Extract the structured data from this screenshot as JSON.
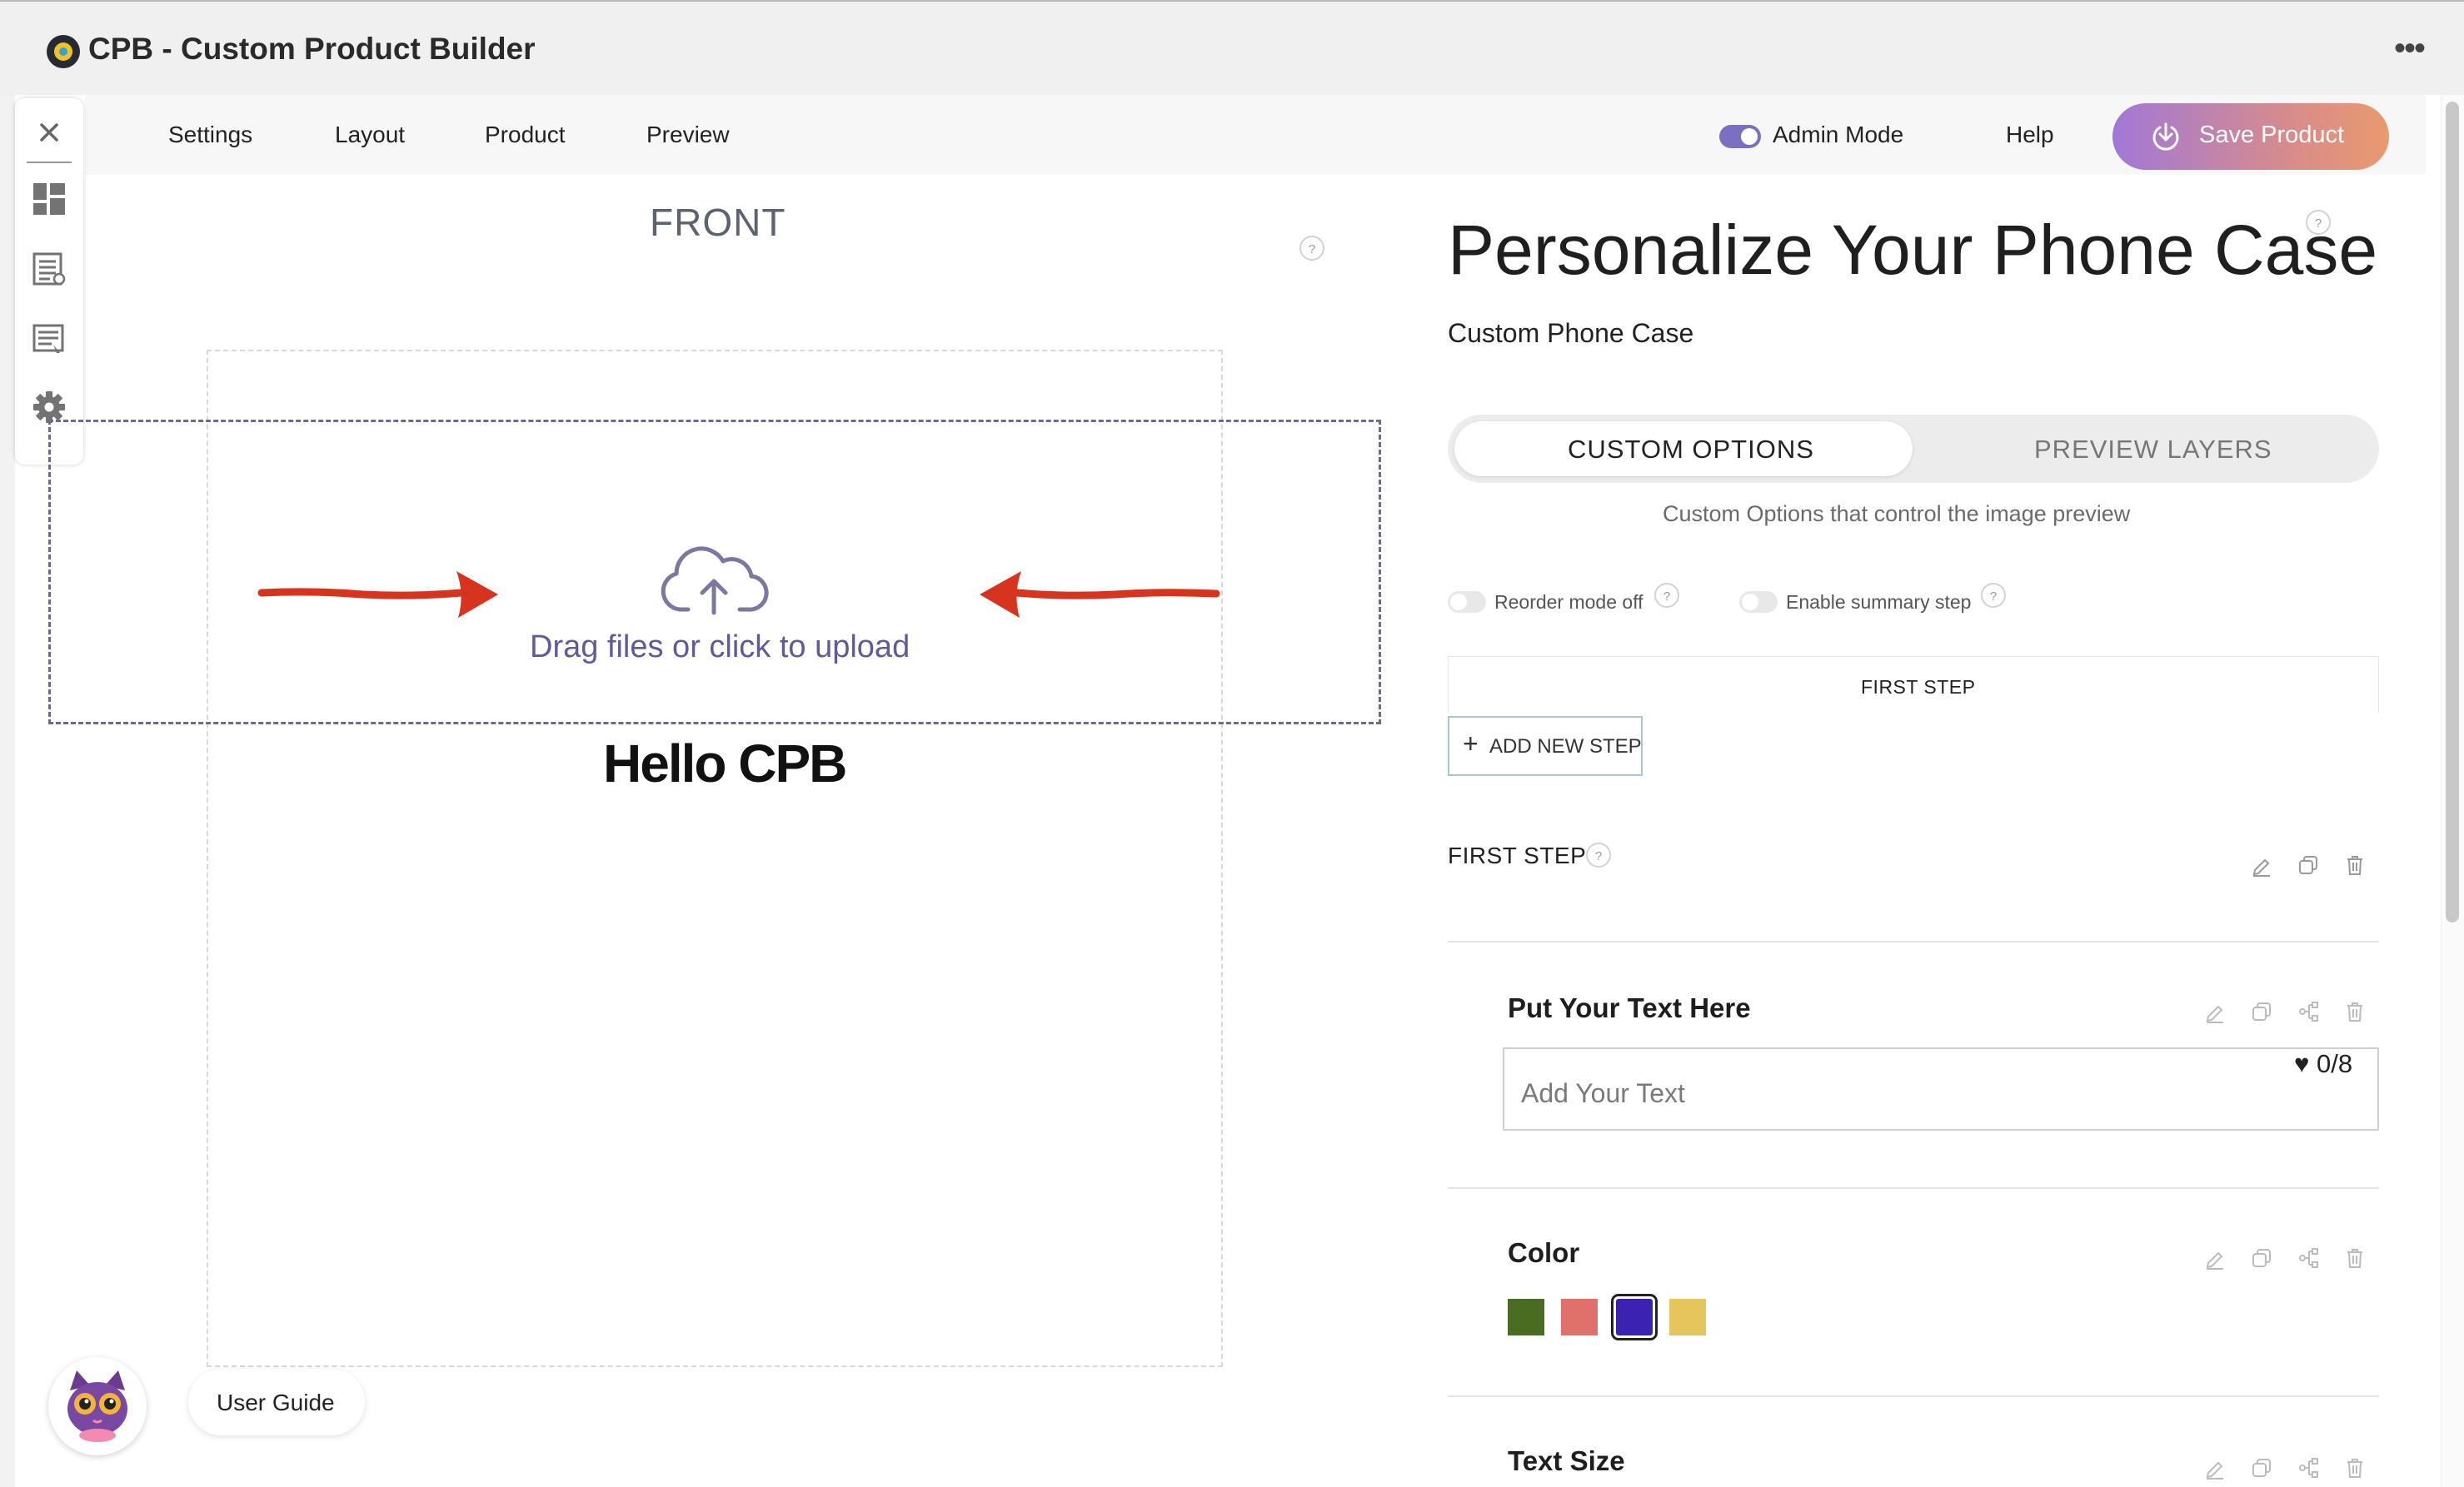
{
  "window": {
    "title": "CPB - Custom Product Builder",
    "more_icon": "more-horizontal-icon"
  },
  "topnav": {
    "items": [
      "Settings",
      "Layout",
      "Product",
      "Preview"
    ],
    "admin_mode": {
      "label": "Admin Mode",
      "enabled": true
    },
    "help": "Help",
    "save": "Save Product"
  },
  "sidebar": {
    "icons": [
      "close-icon",
      "layout-icon",
      "list-icon",
      "image-list-icon",
      "gear-icon"
    ]
  },
  "canvas": {
    "side_label": "FRONT",
    "help": "?",
    "upload_text": "Drag files or click to upload",
    "preview_text": "Hello CPB"
  },
  "panel": {
    "title": "Personalize Your Phone Case",
    "title_help": "?",
    "subtitle": "Custom Phone Case",
    "tabs": {
      "active": "CUSTOM OPTIONS",
      "inactive": "PREVIEW LAYERS"
    },
    "description": "Custom Options that control the image preview",
    "reorder": {
      "label": "Reorder mode off",
      "enabled": false,
      "help": "?"
    },
    "summary": {
      "label": "Enable summary step",
      "enabled": false,
      "help": "?"
    },
    "steps_bar_label": "FIRST STEP",
    "add_step": "ADD NEW STEP",
    "step": {
      "title": "FIRST STEP",
      "help": "?",
      "fields": [
        {
          "label": "Put Your Text Here",
          "placeholder": "Add Your Text",
          "counter": "♥ 0/8"
        },
        {
          "label": "Color",
          "swatches": [
            "#4a6b22",
            "#e0716a",
            "#3b22b3",
            "#e6c65c"
          ],
          "selected": 2
        },
        {
          "label": "Text Size"
        }
      ]
    }
  },
  "user_guide": {
    "label": "User Guide"
  },
  "colors": {
    "accent_start": "#a178d8",
    "accent_end": "#e99a70",
    "upload_text": "#62589a",
    "arrow": "#d6341f"
  }
}
